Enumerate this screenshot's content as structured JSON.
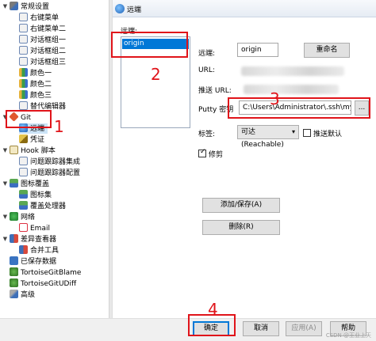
{
  "tree": {
    "items": [
      {
        "label": "常规设置",
        "icon": "wrench-icon",
        "level": 0,
        "expanded": true
      },
      {
        "label": "右键菜单",
        "icon": "dialog-icon",
        "level": 1
      },
      {
        "label": "右键菜单二",
        "icon": "dialog-icon",
        "level": 1
      },
      {
        "label": "对话框组一",
        "icon": "dialog-icon",
        "level": 1
      },
      {
        "label": "对话框组二",
        "icon": "dialog-icon",
        "level": 1
      },
      {
        "label": "对话框组三",
        "icon": "dialog-icon",
        "level": 1
      },
      {
        "label": "颜色一",
        "icon": "color-icon",
        "level": 1
      },
      {
        "label": "颜色二",
        "icon": "color-icon",
        "level": 1
      },
      {
        "label": "颜色三",
        "icon": "color-icon",
        "level": 1
      },
      {
        "label": "替代编辑器",
        "icon": "dialog-icon",
        "level": 1
      },
      {
        "label": "Git",
        "icon": "git-icon",
        "level": 0,
        "expanded": true
      },
      {
        "label": "远端",
        "icon": "globe-icon",
        "level": 1,
        "selected": true
      },
      {
        "label": "凭证",
        "icon": "key-icon",
        "level": 1
      },
      {
        "label": "Hook 脚本",
        "icon": "hook-icon",
        "level": 0,
        "expanded": true
      },
      {
        "label": "问题跟踪器集成",
        "icon": "dialog-icon",
        "level": 1
      },
      {
        "label": "问题跟踪器配置",
        "icon": "dialog-icon",
        "level": 1
      },
      {
        "label": "图标覆盖",
        "icon": "overlay-icon",
        "level": 0,
        "expanded": true
      },
      {
        "label": "图标集",
        "icon": "overlay-icon",
        "level": 1
      },
      {
        "label": "覆盖处理器",
        "icon": "overlay-icon",
        "level": 1
      },
      {
        "label": "网络",
        "icon": "network-icon",
        "level": 0,
        "expanded": true
      },
      {
        "label": "Email",
        "icon": "email-icon",
        "level": 1
      },
      {
        "label": "差异查看器",
        "icon": "diff-icon",
        "level": 0,
        "expanded": true
      },
      {
        "label": "合并工具",
        "icon": "diff-icon",
        "level": 1
      },
      {
        "label": "已保存数据",
        "icon": "save-icon",
        "level": 0
      },
      {
        "label": "TortoiseGitBlame",
        "icon": "tortoise-icon",
        "level": 0
      },
      {
        "label": "TortoiseGitUDiff",
        "icon": "tortoise-icon",
        "level": 0
      },
      {
        "label": "高级",
        "icon": "advanced-icon",
        "level": 0
      }
    ]
  },
  "panel": {
    "title": "远端",
    "list_label": "远端:",
    "remotes": [
      "origin"
    ],
    "remote_label": "远端:",
    "remote_value": "origin",
    "rename_button": "重命名",
    "url_label": "URL:",
    "push_url_label": "推送 URL:",
    "putty_label": "Putty 密钥",
    "putty_value": "C:\\Users\\Administrator\\.ssh\\myPrivite_1",
    "browse_button": "...",
    "tag_label": "标签:",
    "tag_select": "可达 (Reachable)",
    "push_default_label": "推送默认",
    "prune_label": "修剪",
    "add_save_button": "添加/保存(A)",
    "delete_button": "删除(R)"
  },
  "footer": {
    "ok": "确定",
    "cancel": "取消",
    "apply": "应用(A)",
    "help": "帮助",
    "watermark": "CSDN @王业上天"
  },
  "annotations": {
    "n1": "1",
    "n2": "2",
    "n3": "3",
    "n4": "4"
  },
  "colors": {
    "annotation_red": "#e0141a",
    "selection_blue": "#0078d7"
  }
}
